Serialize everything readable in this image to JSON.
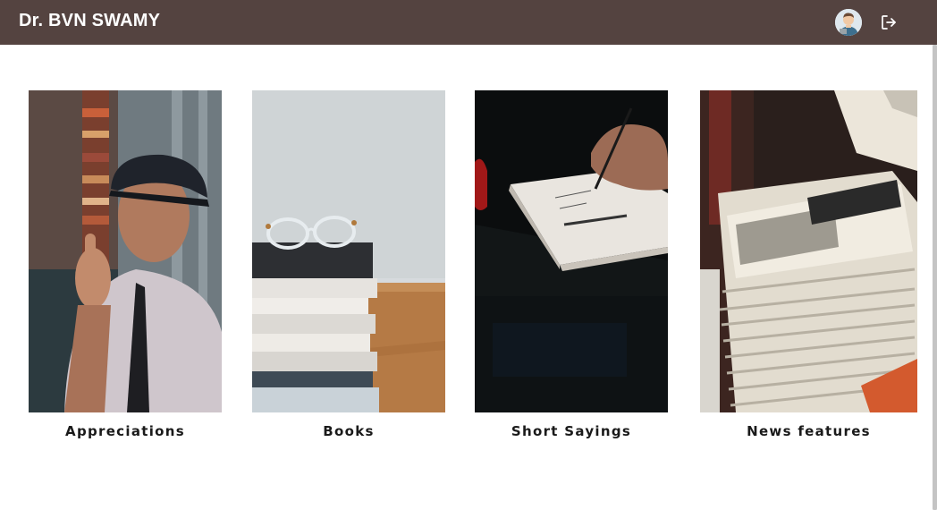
{
  "header": {
    "title": "Dr. BVN SWAMY",
    "avatar_icon": "user-avatar-icon",
    "logout_icon": "logout-icon",
    "background": "#544340"
  },
  "cards": [
    {
      "label": "Appreciations",
      "image": "elderly-man-thumbs-up-photo"
    },
    {
      "label": "Books",
      "image": "stack-of-books-with-glasses-photo"
    },
    {
      "label": "Short Sayings",
      "image": "hand-writing-in-notebook-photo"
    },
    {
      "label": "News features",
      "image": "stack-of-newspapers-photo"
    }
  ]
}
